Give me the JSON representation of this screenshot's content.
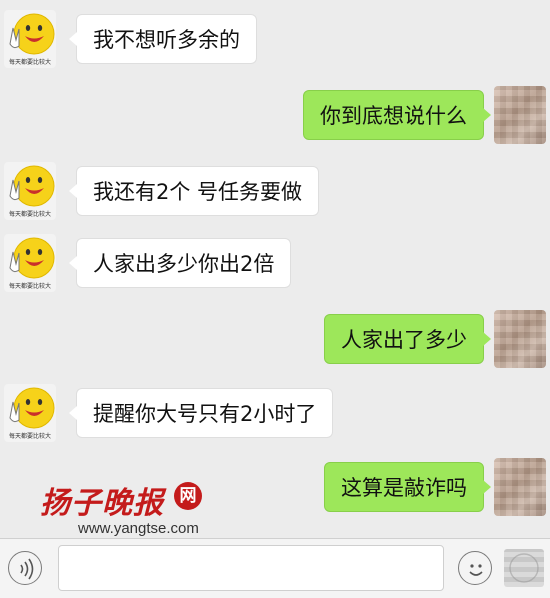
{
  "messages": [
    {
      "side": "left",
      "text": "我不想听多余的"
    },
    {
      "side": "right",
      "text": "你到底想说什么"
    },
    {
      "side": "left",
      "text": "我还有2个 号任务要做"
    },
    {
      "side": "left",
      "text": "人家出多少你出2倍"
    },
    {
      "side": "right",
      "text": "人家出了多少"
    },
    {
      "side": "left",
      "text": "提醒你大号只有2小时了"
    },
    {
      "side": "right",
      "text": "这算是敲诈吗"
    }
  ],
  "sender_avatar": {
    "icon": "smiley-peace-icon",
    "caption": "每天都要比较大"
  },
  "watermark": {
    "title": "扬子晚报",
    "badge": "网",
    "url": "www.yangtse.com"
  },
  "colors": {
    "left_bubble": "#ffffff",
    "right_bubble": "#9de75a",
    "background": "#ececec",
    "brand_red": "#c41b1b"
  },
  "input_bar": {
    "voice_icon": "voice-icon",
    "emoji_icon": "emoji-icon",
    "plus_icon": "plus-icon"
  }
}
